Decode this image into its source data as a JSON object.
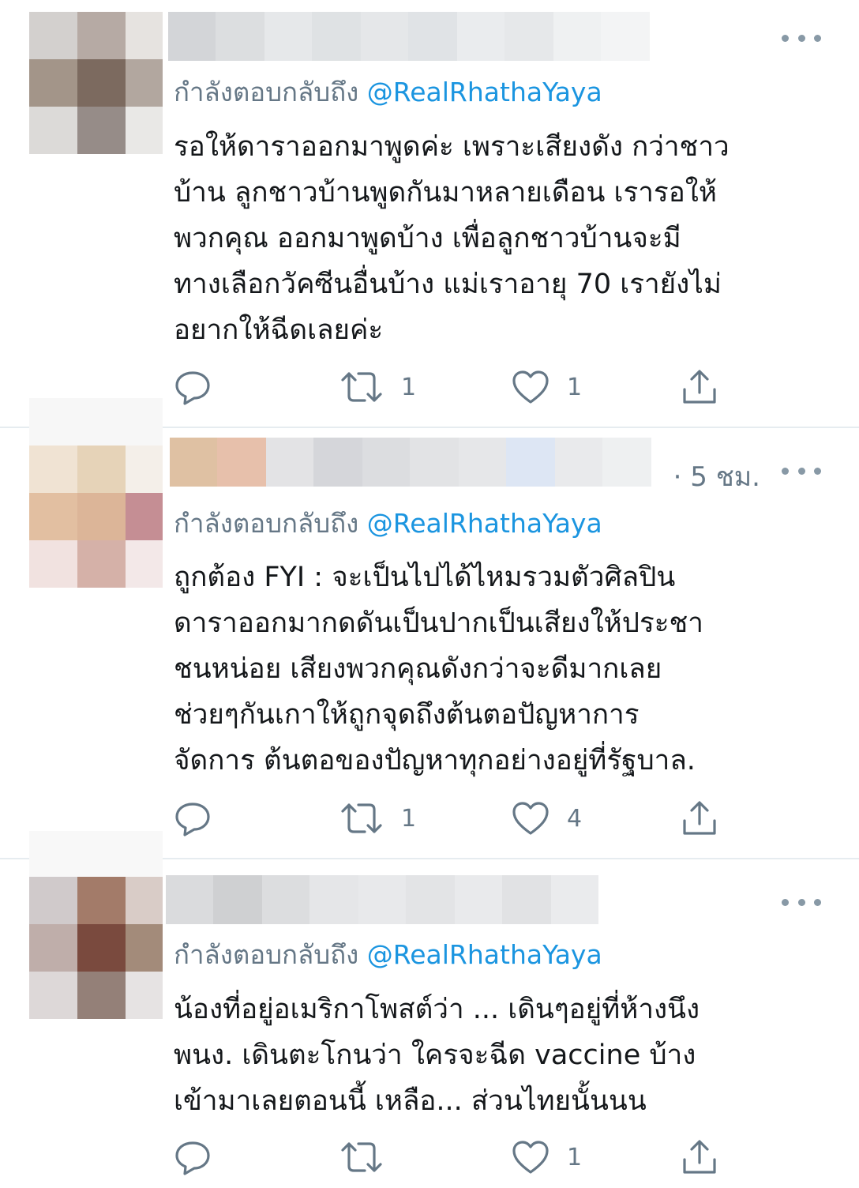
{
  "colors": {
    "text": "#14171a",
    "secondary": "#657786",
    "link": "#1b95e0",
    "divider": "#e6ecf0",
    "icon": "#657786"
  },
  "tweets": [
    {
      "reply_prefix": "กำลังตอบกลับถึง",
      "reply_handle": "@RealRhathaYaya",
      "time": "",
      "lines": [
        "รอให้ดาราออกมาพูดค่ะ เพราะเสียงดัง กว่าชาว",
        "บ้าน ลูกชาวบ้านพูดกันมาหลายเดือน เรารอให้",
        "พวกคุณ ออกมาพูดบ้าง เพื่อลูกชาวบ้านจะมี",
        "ทางเลือกวัคซีนอื่นบ้าง แม่เราอายุ 70 เรายังไม่",
        "อยากให้ฉีดเลยค่ะ"
      ],
      "retweets": "1",
      "likes": "1"
    },
    {
      "reply_prefix": "กำลังตอบกลับถึง",
      "reply_handle": "@RealRhathaYaya",
      "time": "· 5 ชม.",
      "lines": [
        "ถูกต้อง FYI : จะเป็นไปได้ไหมรวมตัวศิลปิน",
        "ดาราออกมากดดันเป็นปากเป็นเสียงให้ประชา",
        "ชนหน่อย เสียงพวกคุณดังกว่าจะดีมากเลย",
        "ช่วยๆกันเกาให้ถูกจุดถึงต้นตอปัญหาการ",
        "จัดการ ต้นตอของปัญหาทุกอย่างอยู่ที่รัฐบาล."
      ],
      "retweets": "1",
      "likes": "4"
    },
    {
      "reply_prefix": "กำลังตอบกลับถึง",
      "reply_handle": "@RealRhathaYaya",
      "time": "",
      "lines": [
        "น้องที่อยู่อเมริกาโพสต์ว่า ... เดินๆอยู่ที่ห้างนึง",
        "พนง. เดินตะโกนว่า ใครจะฉีด vaccine บ้าง",
        "เข้ามาเลยตอนนี้ เหลือ... ส่วนไทยนั้นนน"
      ],
      "retweets": "",
      "likes": "1"
    }
  ],
  "icons": [
    "reply-icon",
    "retweet-icon",
    "like-icon",
    "share-icon",
    "more-icon"
  ]
}
